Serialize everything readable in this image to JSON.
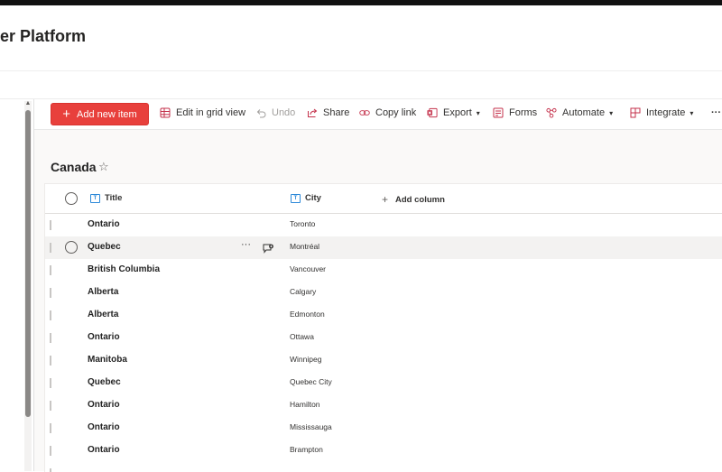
{
  "site": {
    "title": "er Platform"
  },
  "commandbar": {
    "new_item": "Add new item",
    "edit_grid": "Edit in grid view",
    "undo": "Undo",
    "share": "Share",
    "copy_link": "Copy link",
    "export": "Export",
    "forms": "Forms",
    "automate": "Automate",
    "integrate": "Integrate",
    "more": "···"
  },
  "list": {
    "title": "Canada",
    "star": "☆",
    "columns": {
      "title": "Title",
      "city": "City",
      "add_column": "Add column"
    },
    "rows": [
      {
        "title": "Ontario",
        "city": "Toronto"
      },
      {
        "title": "Quebec",
        "city": "Montréal"
      },
      {
        "title": "British Columbia",
        "city": "Vancouver"
      },
      {
        "title": "Alberta",
        "city": "Calgary"
      },
      {
        "title": "Alberta",
        "city": "Edmonton"
      },
      {
        "title": "Ontario",
        "city": "Ottawa"
      },
      {
        "title": "Manitoba",
        "city": "Winnipeg"
      },
      {
        "title": "Quebec",
        "city": "Quebec City"
      },
      {
        "title": "Ontario",
        "city": "Hamilton"
      },
      {
        "title": "Ontario",
        "city": "Mississauga"
      },
      {
        "title": "Ontario",
        "city": "Brampton"
      }
    ],
    "row_more": "···"
  },
  "colors": {
    "accent": "#e8403c",
    "column_icon": "#2b88d8",
    "cmd_icon": "#c4314b"
  },
  "icons": [
    "plus-icon",
    "grid-icon",
    "undo-icon",
    "share-icon",
    "link-icon",
    "export-icon",
    "forms-icon",
    "automate-icon",
    "integrate-icon",
    "star-icon",
    "text-column-icon",
    "comment-icon"
  ]
}
